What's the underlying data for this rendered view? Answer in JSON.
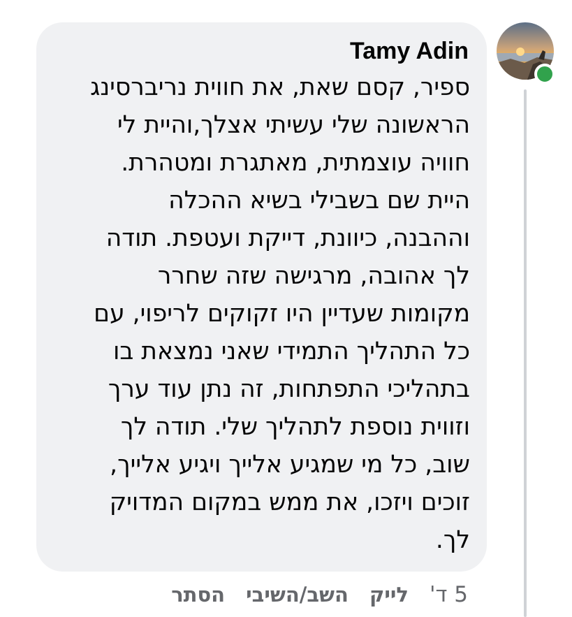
{
  "comment": {
    "author": "Tamy Adin",
    "text_lines": [
      "ספיר, קסם שאת, את חווית נריברסינג",
      "הראשונה שלי עשיתי אצלך,והיית  לי",
      "חוויה עוצמתית, מאתגרת ומטהרת.",
      "היית שם בשבילי בשיא ההכלה",
      "וההבנה, כיוונת, דייקת ועטפת. תודה",
      "לך אהובה, מרגישה שזה שחרר",
      "מקומות שעדיין היו זקוקים לריפוי, עם",
      "כל התהליך התמידי שאני נמצאת בו",
      "בתהליכי התפתחות, זה נתן עוד ערך",
      "וזווית נוספת לתהליך שלי. תודה לך",
      "שוב, כל מי שמגיע אלייך ויגיע אלייך,",
      "זוכים ויזכו, את ממש במקום המדויק",
      "לך."
    ]
  },
  "actions": {
    "timestamp": "5 ד'",
    "like_label": "לייק",
    "reply_label": "השב/השיבי",
    "hide_label": "הסתר"
  },
  "avatar": {
    "icon": "profile-photo-sunset-icon",
    "online_status_color": "#31a24c"
  },
  "colors": {
    "bubble_background": "#f0f1f3",
    "text": "#050505",
    "secondary_text": "#65676b"
  }
}
